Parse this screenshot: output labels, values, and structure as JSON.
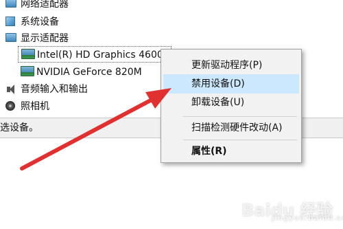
{
  "tree": {
    "items": [
      {
        "label": "网络适配器",
        "icon": "network-adapter-icon"
      },
      {
        "label": "系统设备",
        "icon": "system-device-icon"
      },
      {
        "label": "显示适配器",
        "icon": "display-adapter-icon"
      },
      {
        "label": "Intel(R) HD Graphics 4600",
        "icon": "gpu-icon"
      },
      {
        "label": "NVIDIA GeForce 820M",
        "icon": "gpu-icon"
      },
      {
        "label": "音频输入和输出",
        "icon": "speaker-icon"
      },
      {
        "label": "照相机",
        "icon": "camera-icon"
      }
    ]
  },
  "status_bar": {
    "text": "选设备。"
  },
  "context_menu": {
    "items": [
      {
        "label": "更新驱动程序(P)"
      },
      {
        "label": "禁用设备(D)",
        "highlighted": true
      },
      {
        "label": "卸载设备(U)"
      },
      {
        "label": "扫描检测硬件改动(A)"
      },
      {
        "label": "属性(R)",
        "bold": true
      }
    ]
  },
  "annotation": {
    "arrow_color": "#e03030"
  },
  "watermark": {
    "text": "Baidu 经验",
    "sub": "jingyan.baidu.com"
  },
  "colors": {
    "highlight": "#cce8ff",
    "menu_bg": "#f2f2f2",
    "status_bg": "#f0f0f0"
  }
}
